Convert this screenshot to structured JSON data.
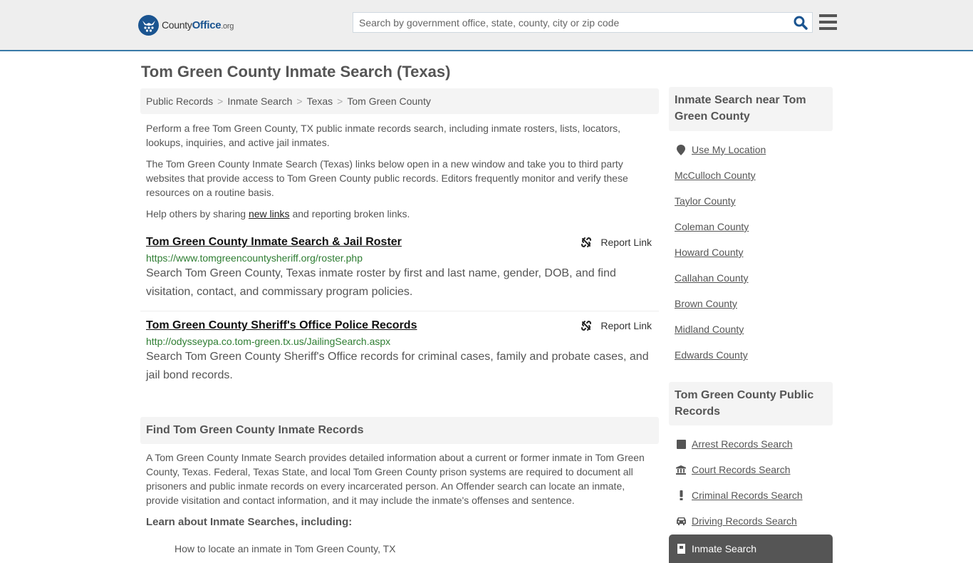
{
  "header": {
    "logo": {
      "name_part1": "County",
      "name_part2": "Office",
      "name_part3": ".org"
    },
    "search": {
      "placeholder": "Search by government office, state, county, city or zip code",
      "value": ""
    },
    "colors": {
      "brand": "#1a5490",
      "header_bg": "#eeeeee",
      "header_border": "#3a7aa8"
    }
  },
  "page_title": "Tom Green County Inmate Search (Texas)",
  "breadcrumb": [
    {
      "label": "Public Records"
    },
    {
      "label": "Inmate Search"
    },
    {
      "label": "Texas"
    },
    {
      "label": "Tom Green County"
    }
  ],
  "breadcrumb_separator": ">",
  "intro": {
    "p1": "Perform a free Tom Green County, TX public inmate records search, including inmate rosters, lists, locators, lookups, inquiries, and active jail inmates.",
    "p2": "The Tom Green County Inmate Search (Texas) links below open in a new window and take you to third party websites that provide access to Tom Green County public records. Editors frequently monitor and verify these resources on a routine basis.",
    "p3_before": "Help others by sharing ",
    "p3_link": "new links",
    "p3_after": " and reporting broken links."
  },
  "links": [
    {
      "title": "Tom Green County Inmate Search & Jail Roster",
      "url": "https://www.tomgreencountysheriff.org/roster.php",
      "description": "Search Tom Green County, Texas inmate roster by first and last name, gender, DOB, and find visitation, contact, and commissary program policies.",
      "report_label": "Report Link"
    },
    {
      "title": "Tom Green County Sheriff's Office Police Records",
      "url": "http://odysseypa.co.tom-green.tx.us/JailingSearch.aspx",
      "description": "Search Tom Green County Sheriff's Office records for criminal cases, family and probate cases, and jail bond records.",
      "report_label": "Report Link"
    }
  ],
  "find_section": {
    "heading": "Find Tom Green County Inmate Records",
    "body": "A Tom Green County Inmate Search provides detailed information about a current or former inmate in Tom Green County, Texas. Federal, Texas State, and local Tom Green County prison systems are required to document all prisoners and public inmate records on every incarcerated person. An Offender search can locate an inmate, provide visitation and contact information, and it may include the inmate's offenses and sentence.",
    "learn_heading": "Learn about Inmate Searches, including:",
    "learn_items": [
      "How to locate an inmate in Tom Green County, TX"
    ]
  },
  "sidebar": {
    "near_heading": "Inmate Search near Tom Green County",
    "use_location": {
      "label": "Use My Location",
      "icon": "map-marker-icon"
    },
    "nearby": [
      "McCulloch County",
      "Taylor County",
      "Coleman County",
      "Howard County",
      "Callahan County",
      "Brown County",
      "Midland County",
      "Edwards County"
    ],
    "records_heading": "Tom Green County Public Records",
    "records": [
      {
        "label": "Arrest Records Search",
        "icon": "square-icon"
      },
      {
        "label": "Court Records Search",
        "icon": "courthouse-icon"
      },
      {
        "label": "Criminal Records Search",
        "icon": "exclamation-icon"
      },
      {
        "label": "Driving Records Search",
        "icon": "car-icon"
      }
    ],
    "active_record": {
      "label": "Inmate Search",
      "icon": "jail-door-icon"
    }
  }
}
